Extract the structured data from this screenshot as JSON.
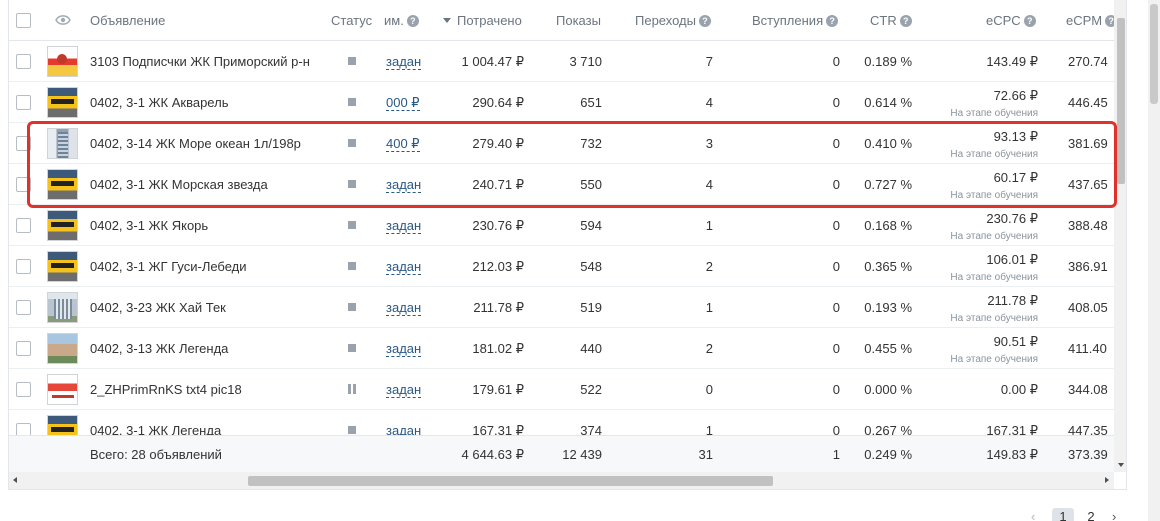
{
  "columns": {
    "ad": "Объявление",
    "status": "Статус",
    "budget": "им.",
    "spent": "Потрачено",
    "impressions": "Показы",
    "clicks": "Переходы",
    "joins": "Вступления",
    "ctr": "CTR",
    "ecpc": "eCPC",
    "ecpm": "eCPM"
  },
  "help_glyph": "?",
  "rows": [
    {
      "name": "3103 Подписчки ЖК Приморский р-н",
      "budget": "задан",
      "spent": "1 004.47 ₽",
      "impressions": "3 710",
      "clicks": "7",
      "joins": "0",
      "ctr": "0.189 %",
      "ecpc": "143.49 ₽",
      "ecpc_note": "",
      "ecpm": "270.74"
    },
    {
      "name": "0402, 3-1 ЖК Акварель",
      "budget": "000 ₽",
      "spent": "290.64 ₽",
      "impressions": "651",
      "clicks": "4",
      "joins": "0",
      "ctr": "0.614 %",
      "ecpc": "72.66 ₽",
      "ecpc_note": "На этапе обучения",
      "ecpm": "446.45"
    },
    {
      "name": "0402, 3-14 ЖК Море океан 1л/198р",
      "budget": "400 ₽",
      "spent": "279.40 ₽",
      "impressions": "732",
      "clicks": "3",
      "joins": "0",
      "ctr": "0.410 %",
      "ecpc": "93.13 ₽",
      "ecpc_note": "На этапе обучения",
      "ecpm": "381.69"
    },
    {
      "name": "0402, 3-1 ЖК Морская звезда",
      "budget": "задан",
      "spent": "240.71 ₽",
      "impressions": "550",
      "clicks": "4",
      "joins": "0",
      "ctr": "0.727 %",
      "ecpc": "60.17 ₽",
      "ecpc_note": "На этапе обучения",
      "ecpm": "437.65"
    },
    {
      "name": "0402, 3-1 ЖК Якорь",
      "budget": "задан",
      "spent": "230.76 ₽",
      "impressions": "594",
      "clicks": "1",
      "joins": "0",
      "ctr": "0.168 %",
      "ecpc": "230.76 ₽",
      "ecpc_note": "На этапе обучения",
      "ecpm": "388.48"
    },
    {
      "name": "0402, 3-1 ЖГ Гуси-Лебеди",
      "budget": "задан",
      "spent": "212.03 ₽",
      "impressions": "548",
      "clicks": "2",
      "joins": "0",
      "ctr": "0.365 %",
      "ecpc": "106.01 ₽",
      "ecpc_note": "На этапе обучения",
      "ecpm": "386.91"
    },
    {
      "name": "0402, 3-23 ЖК Хай Тек",
      "budget": "задан",
      "spent": "211.78 ₽",
      "impressions": "519",
      "clicks": "1",
      "joins": "0",
      "ctr": "0.193 %",
      "ecpc": "211.78 ₽",
      "ecpc_note": "На этапе обучения",
      "ecpm": "408.05"
    },
    {
      "name": "0402, 3-13 ЖК Легенда",
      "budget": "задан",
      "spent": "181.02 ₽",
      "impressions": "440",
      "clicks": "2",
      "joins": "0",
      "ctr": "0.455 %",
      "ecpc": "90.51 ₽",
      "ecpc_note": "На этапе обучения",
      "ecpm": "411.40"
    },
    {
      "name": "2_ZHPrimRnKS txt4 pic18",
      "budget": "задан",
      "spent": "179.61 ₽",
      "impressions": "522",
      "clicks": "0",
      "joins": "0",
      "ctr": "0.000 %",
      "ecpc": "0.00 ₽",
      "ecpc_note": "",
      "ecpm": "344.08"
    },
    {
      "name": "0402, 3-1 ЖК Легенда",
      "budget": "задан",
      "spent": "167.31 ₽",
      "impressions": "374",
      "clicks": "1",
      "joins": "0",
      "ctr": "0.267 %",
      "ecpc": "167.31 ₽",
      "ecpc_note": "",
      "ecpm": "447.35"
    }
  ],
  "row_status": [
    "stop",
    "stop",
    "stop",
    "stop",
    "stop",
    "stop",
    "stop",
    "stop",
    "pause",
    "stop"
  ],
  "row_thumbs": [
    "kids-icon",
    "yellow-banner-icon",
    "tower-icon",
    "yellow-banner-icon",
    "yellow-banner-icon",
    "yellow-banner-icon",
    "building-icon",
    "city-icon",
    "red-banner-icon",
    "yellow-banner-icon"
  ],
  "totals": {
    "label": "Всего: 28 объявлений",
    "spent": "4 644.63 ₽",
    "impressions": "12 439",
    "clicks": "31",
    "joins": "1",
    "ctr": "0.249 %",
    "ecpc": "149.83 ₽",
    "ecpm": "373.39"
  },
  "pagination": {
    "prev": "‹",
    "pages": [
      "1",
      "2"
    ],
    "current": "1",
    "next": "›"
  },
  "colors": {
    "link": "#2a5885",
    "highlight": "#e0322b"
  }
}
